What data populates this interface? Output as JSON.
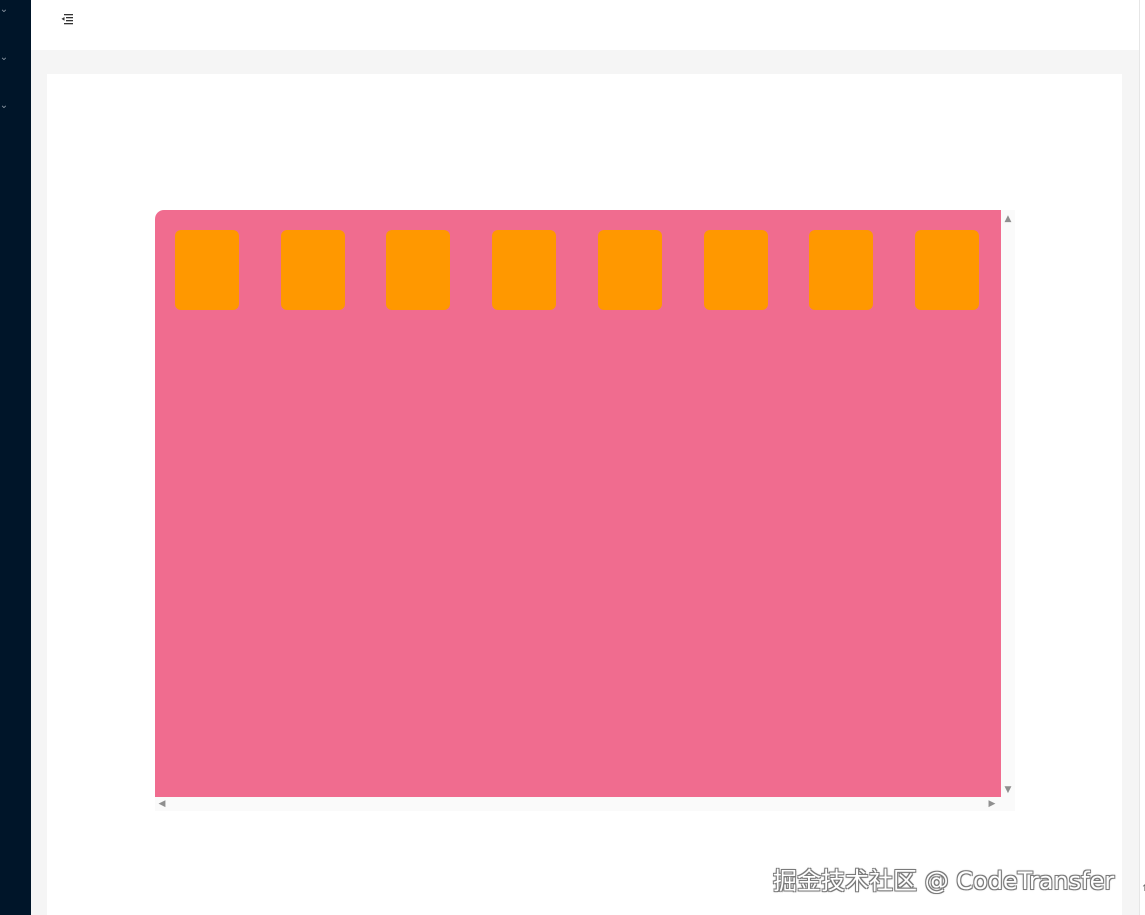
{
  "sidebar": {
    "chevrons": [
      "chevron-down-icon",
      "chevron-down-icon",
      "chevron-down-icon"
    ]
  },
  "header": {
    "collapse_icon": "menu-fold-icon"
  },
  "scroll_area": {
    "background_color": "#f06c8f",
    "tile_color": "#ff9800",
    "tile_count": 8
  },
  "scrollbars": {
    "up_arrow": "▲",
    "down_arrow": "▼",
    "left_arrow": "◀",
    "right_arrow": "▶"
  },
  "corner_mark": "↑",
  "watermark": "掘金技术社区 @ CodeTransfer"
}
